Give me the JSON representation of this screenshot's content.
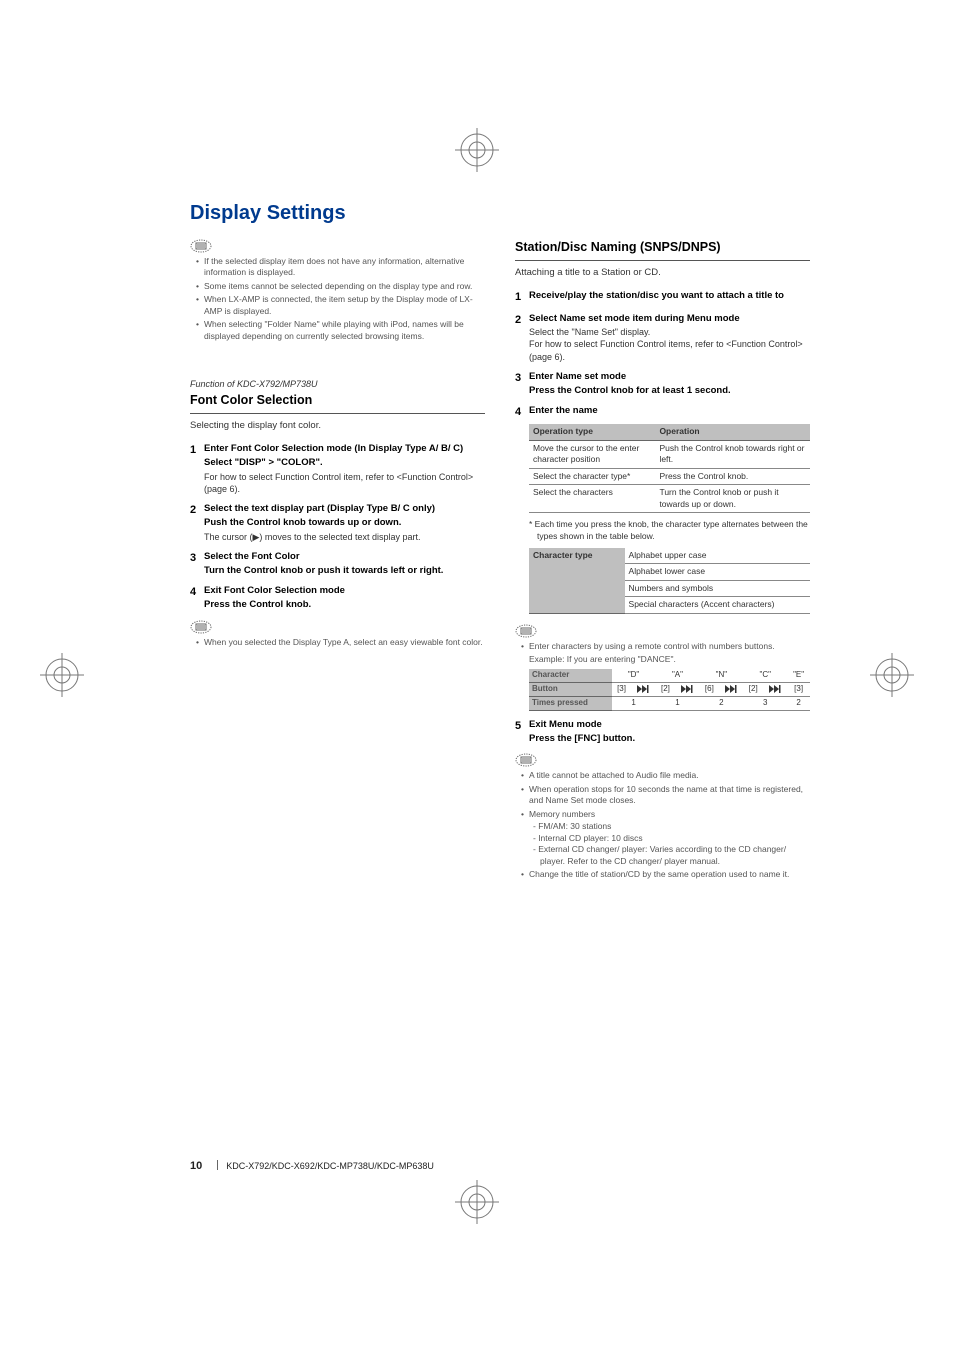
{
  "section_title": "Display Settings",
  "left": {
    "intro_bullets": [
      "If the selected display item does not have any information, alternative information is displayed.",
      "Some items cannot be selected depending on the display type and row.",
      "When LX-AMP is connected, the item setup by the Display mode of LX-AMP is displayed.",
      "When selecting \"Folder Name\" while playing with iPod, names will be displayed depending on currently selected browsing items."
    ],
    "function_of": "Function of KDC-X792/MP738U",
    "topic": "Font Color Selection",
    "lead": "Selecting the display font color.",
    "steps": [
      {
        "num": "1",
        "title": "Enter Font Color Selection mode (In Display Type A/ B/ C)",
        "action": "Select \"DISP\" > \"COLOR\".",
        "desc": "For how to select Function Control item, refer to <Function Control> (page 6)."
      },
      {
        "num": "2",
        "title": "Select the text display part (Display Type B/ C only)",
        "action": "Push the Control knob towards up or down.",
        "desc": "The cursor (▶) moves to the selected text display part."
      },
      {
        "num": "3",
        "title": "Select the Font Color",
        "action": "Turn the Control knob or push it towards left or right."
      },
      {
        "num": "4",
        "title": "Exit Font Color Selection mode",
        "action": "Press the Control knob."
      }
    ],
    "post_bullet": "When you selected the Display Type A, select an easy viewable font color."
  },
  "right": {
    "topic": "Station/Disc Naming (SNPS/DNPS)",
    "lead": "Attaching a title to a Station or CD.",
    "steps": [
      {
        "num": "1",
        "title": "Receive/play the station/disc you want to attach a title to"
      },
      {
        "num": "2",
        "title": "Select Name set mode item during Menu mode",
        "desc": "Select the \"Name Set\" display.\nFor how to select Function Control items, refer to <Function Control> (page 6)."
      },
      {
        "num": "3",
        "title": "Enter Name set mode",
        "action": "Press the Control knob for at least 1 second."
      },
      {
        "num": "4",
        "title": "Enter the name"
      }
    ],
    "op_table": {
      "head": [
        "Operation type",
        "Operation"
      ],
      "rows": [
        [
          "Move the cursor to the enter character position",
          "Push the Control knob towards right or left."
        ],
        [
          "Select the character type*",
          "Press the Control knob."
        ],
        [
          "Select the characters",
          "Turn the Control knob or push it towards up or down."
        ]
      ]
    },
    "star_note": "* Each time you press the knob, the character type alternates between the types shown in the table below.",
    "ct_table": {
      "label": "Character type",
      "lines": [
        "Alphabet upper case",
        "Alphabet lower case",
        "Numbers and symbols",
        "Special characters (Accent characters)"
      ]
    },
    "mid_bullets_lead": "Enter characters by using a remote control with numbers buttons.",
    "example_lead": "Example: If you are entering \"DANCE\".",
    "ex_table": {
      "row_labels": [
        "Character",
        "Button",
        "Times pressed"
      ],
      "cols": [
        "\"D\"",
        "\"A\"",
        "\"N\"",
        "\"C\"",
        "\"E\""
      ],
      "button_cells": [
        "[3]",
        "skip",
        "[2]",
        "skip",
        "[6]",
        "skip",
        "[2]",
        "skip",
        "[3]"
      ],
      "times": [
        "1",
        "1",
        "2",
        "3",
        "2"
      ]
    },
    "step5": {
      "num": "5",
      "title": "Exit Menu mode",
      "action": "Press the [FNC] button."
    },
    "tail_bullets": [
      "A title cannot be attached to Audio file media.",
      "When operation stops for 10 seconds the name at that time is registered, and Name Set mode closes.",
      "Memory numbers",
      "Change the title of station/CD by the same operation used to name it."
    ],
    "memory_sub": [
      "- FM/AM: 30 stations",
      "- Internal CD player: 10 discs",
      "- External CD changer/ player: Varies according to the CD changer/ player. Refer to the CD changer/ player manual."
    ]
  },
  "footer": {
    "page": "10",
    "models": "KDC-X792/KDC-X692/KDC-MP738U/KDC-MP638U"
  }
}
